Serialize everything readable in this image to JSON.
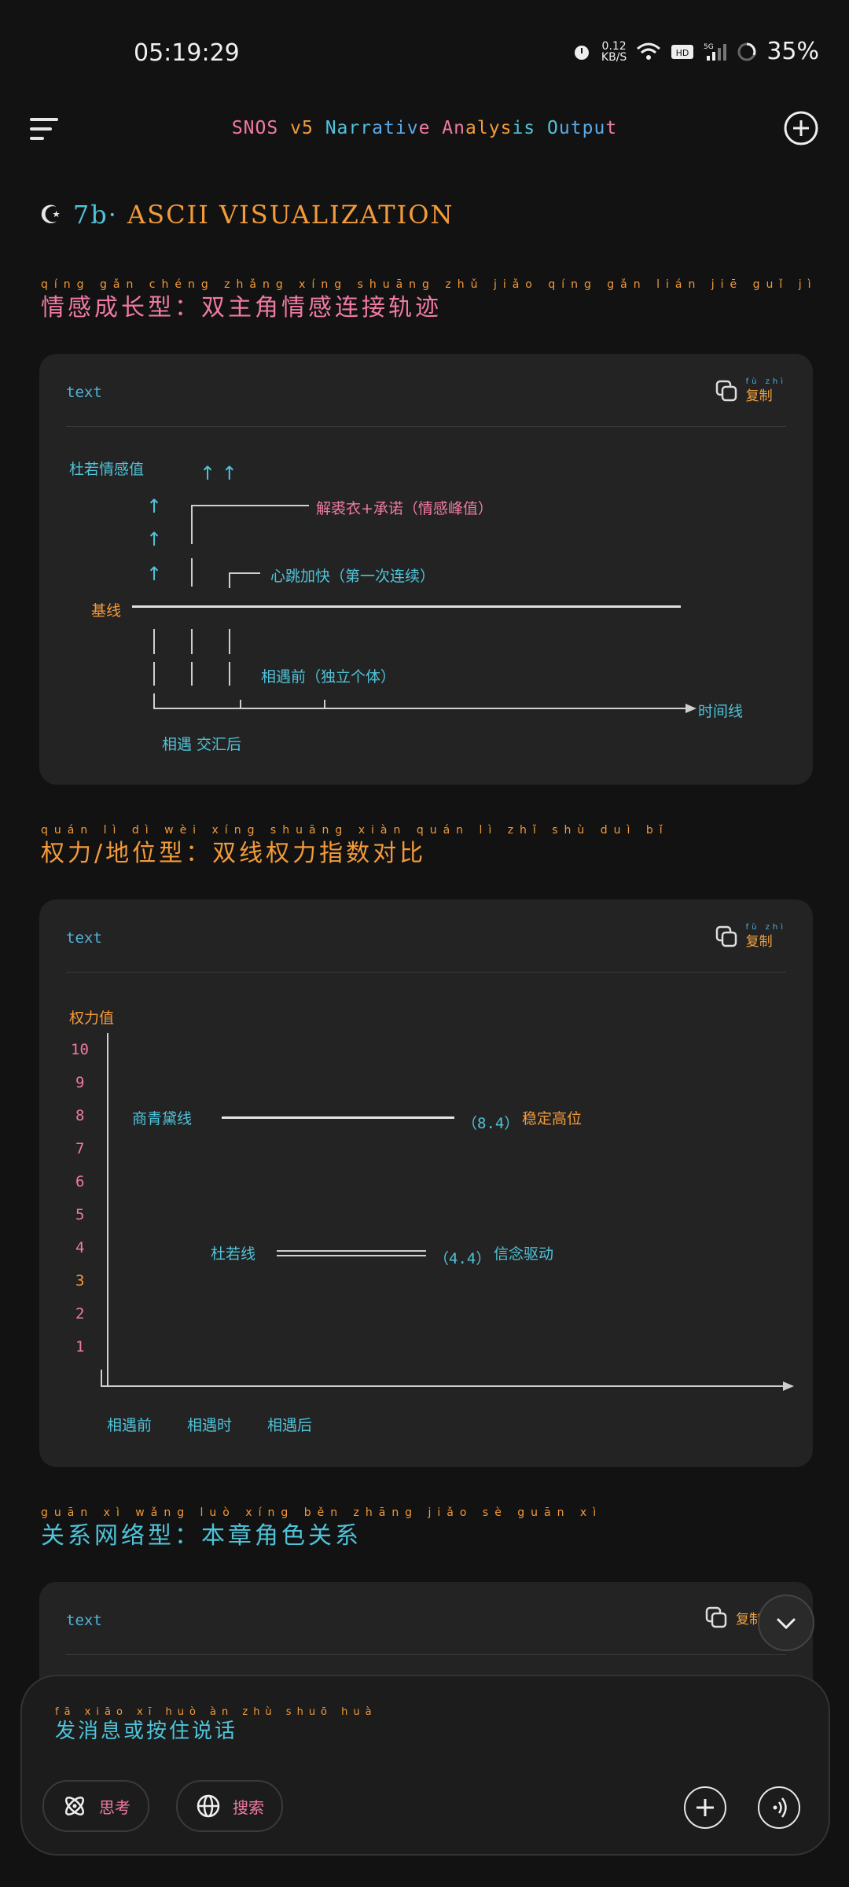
{
  "status": {
    "time": "05:19:29",
    "speed_value": "0.12",
    "speed_unit": "KB/S",
    "battery": "35%",
    "hd_label": "HD",
    "network_label": "5G"
  },
  "header": {
    "title": "SNOS v5 Narrative Analysis Output"
  },
  "section": {
    "number": "7b·",
    "title": "ASCII VISUALIZATION"
  },
  "block1": {
    "heading": "情感成长型：双主角情感连接轨迹",
    "heading_pinyin": "qíng gǎn chéng zhǎng xíng shuāng zhǔ jiǎo qíng gǎn lián jiē guǐ jì",
    "lang": "text",
    "copy": "复制",
    "copy_pinyin": "fù zhì",
    "y_label": "杜若情感值",
    "arrows": "↑ ↑",
    "event1": "解裘衣+承诺（情感峰值）",
    "event2": "心跳加快（第一次连续）",
    "baseline": "基线",
    "event3": "相遇前（独立个体）",
    "x_label": "时间线",
    "bottom": "相遇  交汇后"
  },
  "block2": {
    "heading": "权力/地位型：双线权力指数对比",
    "heading_pinyin": "quán lì dì wèi xíng shuāng xiàn quán lì zhǐ shù duì bǐ",
    "lang": "text",
    "copy": "复制",
    "copy_pinyin": "fù zhì",
    "y_label": "权力值",
    "y_ticks": [
      "10",
      "9",
      "8",
      "7",
      "6",
      "5",
      "4",
      "3",
      "2",
      "1"
    ],
    "series": [
      {
        "name": "商青黛线",
        "value": "（8.4）",
        "desc": "稳定高位"
      },
      {
        "name": "杜若线",
        "value": "（4.4）",
        "desc": "信念驱动"
      }
    ],
    "x_labels": [
      "相遇前",
      "相遇时",
      "相遇后"
    ]
  },
  "block3": {
    "heading": "关系网络型：本章角色关系",
    "heading_pinyin": "guān xì wǎng luò xíng běn zhāng jiǎo sè guān xì",
    "lang": "text",
    "copy": "复制"
  },
  "composer": {
    "placeholder": "发消息或按住说话",
    "placeholder_pinyin": "fā xiāo xī huò àn zhù shuō huà",
    "think_label": "思考",
    "search_label": "搜索"
  }
}
